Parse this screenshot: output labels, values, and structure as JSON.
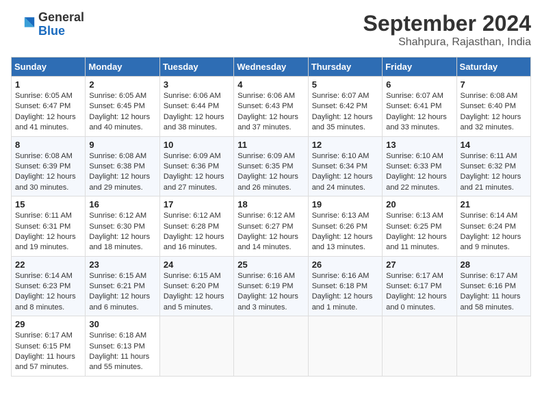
{
  "header": {
    "logo_general": "General",
    "logo_blue": "Blue",
    "title": "September 2024",
    "subtitle": "Shahpura, Rajasthan, India"
  },
  "calendar": {
    "days_of_week": [
      "Sunday",
      "Monday",
      "Tuesday",
      "Wednesday",
      "Thursday",
      "Friday",
      "Saturday"
    ],
    "weeks": [
      [
        {
          "day": "1",
          "sunrise": "6:05 AM",
          "sunset": "6:47 PM",
          "daylight": "12 hours and 41 minutes."
        },
        {
          "day": "2",
          "sunrise": "6:05 AM",
          "sunset": "6:45 PM",
          "daylight": "12 hours and 40 minutes."
        },
        {
          "day": "3",
          "sunrise": "6:06 AM",
          "sunset": "6:44 PM",
          "daylight": "12 hours and 38 minutes."
        },
        {
          "day": "4",
          "sunrise": "6:06 AM",
          "sunset": "6:43 PM",
          "daylight": "12 hours and 37 minutes."
        },
        {
          "day": "5",
          "sunrise": "6:07 AM",
          "sunset": "6:42 PM",
          "daylight": "12 hours and 35 minutes."
        },
        {
          "day": "6",
          "sunrise": "6:07 AM",
          "sunset": "6:41 PM",
          "daylight": "12 hours and 33 minutes."
        },
        {
          "day": "7",
          "sunrise": "6:08 AM",
          "sunset": "6:40 PM",
          "daylight": "12 hours and 32 minutes."
        }
      ],
      [
        {
          "day": "8",
          "sunrise": "6:08 AM",
          "sunset": "6:39 PM",
          "daylight": "12 hours and 30 minutes."
        },
        {
          "day": "9",
          "sunrise": "6:08 AM",
          "sunset": "6:38 PM",
          "daylight": "12 hours and 29 minutes."
        },
        {
          "day": "10",
          "sunrise": "6:09 AM",
          "sunset": "6:36 PM",
          "daylight": "12 hours and 27 minutes."
        },
        {
          "day": "11",
          "sunrise": "6:09 AM",
          "sunset": "6:35 PM",
          "daylight": "12 hours and 26 minutes."
        },
        {
          "day": "12",
          "sunrise": "6:10 AM",
          "sunset": "6:34 PM",
          "daylight": "12 hours and 24 minutes."
        },
        {
          "day": "13",
          "sunrise": "6:10 AM",
          "sunset": "6:33 PM",
          "daylight": "12 hours and 22 minutes."
        },
        {
          "day": "14",
          "sunrise": "6:11 AM",
          "sunset": "6:32 PM",
          "daylight": "12 hours and 21 minutes."
        }
      ],
      [
        {
          "day": "15",
          "sunrise": "6:11 AM",
          "sunset": "6:31 PM",
          "daylight": "12 hours and 19 minutes."
        },
        {
          "day": "16",
          "sunrise": "6:12 AM",
          "sunset": "6:30 PM",
          "daylight": "12 hours and 18 minutes."
        },
        {
          "day": "17",
          "sunrise": "6:12 AM",
          "sunset": "6:28 PM",
          "daylight": "12 hours and 16 minutes."
        },
        {
          "day": "18",
          "sunrise": "6:12 AM",
          "sunset": "6:27 PM",
          "daylight": "12 hours and 14 minutes."
        },
        {
          "day": "19",
          "sunrise": "6:13 AM",
          "sunset": "6:26 PM",
          "daylight": "12 hours and 13 minutes."
        },
        {
          "day": "20",
          "sunrise": "6:13 AM",
          "sunset": "6:25 PM",
          "daylight": "12 hours and 11 minutes."
        },
        {
          "day": "21",
          "sunrise": "6:14 AM",
          "sunset": "6:24 PM",
          "daylight": "12 hours and 9 minutes."
        }
      ],
      [
        {
          "day": "22",
          "sunrise": "6:14 AM",
          "sunset": "6:23 PM",
          "daylight": "12 hours and 8 minutes."
        },
        {
          "day": "23",
          "sunrise": "6:15 AM",
          "sunset": "6:21 PM",
          "daylight": "12 hours and 6 minutes."
        },
        {
          "day": "24",
          "sunrise": "6:15 AM",
          "sunset": "6:20 PM",
          "daylight": "12 hours and 5 minutes."
        },
        {
          "day": "25",
          "sunrise": "6:16 AM",
          "sunset": "6:19 PM",
          "daylight": "12 hours and 3 minutes."
        },
        {
          "day": "26",
          "sunrise": "6:16 AM",
          "sunset": "6:18 PM",
          "daylight": "12 hours and 1 minute."
        },
        {
          "day": "27",
          "sunrise": "6:17 AM",
          "sunset": "6:17 PM",
          "daylight": "12 hours and 0 minutes."
        },
        {
          "day": "28",
          "sunrise": "6:17 AM",
          "sunset": "6:16 PM",
          "daylight": "11 hours and 58 minutes."
        }
      ],
      [
        {
          "day": "29",
          "sunrise": "6:17 AM",
          "sunset": "6:15 PM",
          "daylight": "11 hours and 57 minutes."
        },
        {
          "day": "30",
          "sunrise": "6:18 AM",
          "sunset": "6:13 PM",
          "daylight": "11 hours and 55 minutes."
        },
        null,
        null,
        null,
        null,
        null
      ]
    ]
  }
}
